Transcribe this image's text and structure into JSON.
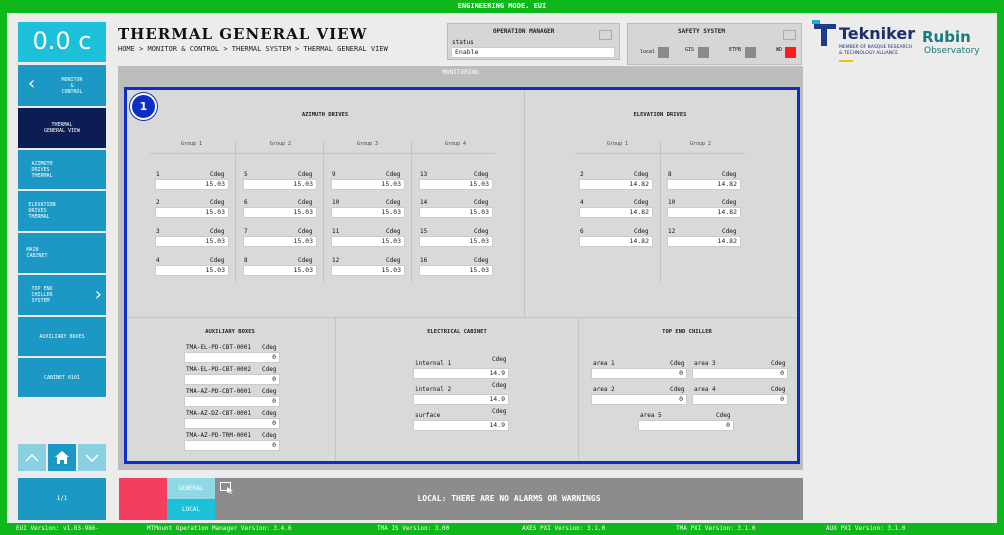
{
  "topbar": {
    "title": "ENGINEERING MODE. EUI"
  },
  "temperature": "0.0 c",
  "nav": {
    "items": [
      {
        "label": "MONITOR\n&\nCONTROL"
      },
      {
        "label": "THERMAL\nGENERAL VIEW"
      },
      {
        "label": "AZIMUTH\nDRIVES\nTHERMAL"
      },
      {
        "label": "ELEVATION\nDRIVES\nTHERMAL"
      },
      {
        "label": "MAIN\nCABINET"
      },
      {
        "label": "TOP END\nCHILLER\nSYSTEM"
      },
      {
        "label": "AUXILIARY BOXES"
      },
      {
        "label": "CABINET 0101"
      }
    ],
    "pager": "1/1"
  },
  "header": {
    "title": "THERMAL GENERAL VIEW",
    "breadcrumb": "HOME > MONITOR & CONTROL > THERMAL SYSTEM > THERMAL GENERAL VIEW"
  },
  "operation_manager": {
    "title": "OPERATION MANAGER",
    "status_label": "status",
    "status_value": "Enable"
  },
  "safety_system": {
    "title": "SAFETY SYSTEM",
    "items": [
      {
        "label": "local",
        "color": "#8a8a8a"
      },
      {
        "label": "GIS",
        "color": "#8a8a8a"
      },
      {
        "label": "ETPB",
        "color": "#8a8a8a"
      },
      {
        "label": "WD",
        "color": "#ff1a1a"
      }
    ]
  },
  "logos": {
    "tekniker": "Tekniker",
    "tekniker_sub1": "MEMBER OF BASQUE RESEARCH",
    "tekniker_sub2": "& TECHNOLOGY ALLIANCE",
    "rubin1": "Rubin",
    "rubin2": "Observatory"
  },
  "monitoring": {
    "title": "MONITORING",
    "badge": "1",
    "azimuth": {
      "title": "AZIMUTH DRIVES",
      "unit": "Cdeg",
      "groups": [
        {
          "name": "Group 1",
          "drives": [
            {
              "id": "1",
              "value": "15.03"
            },
            {
              "id": "2",
              "value": "15.03"
            },
            {
              "id": "3",
              "value": "15.03"
            },
            {
              "id": "4",
              "value": "15.03"
            }
          ]
        },
        {
          "name": "Group 2",
          "drives": [
            {
              "id": "5",
              "value": "15.03"
            },
            {
              "id": "6",
              "value": "15.03"
            },
            {
              "id": "7",
              "value": "15.03"
            },
            {
              "id": "8",
              "value": "15.03"
            }
          ]
        },
        {
          "name": "Group 3",
          "drives": [
            {
              "id": "9",
              "value": "15.03"
            },
            {
              "id": "10",
              "value": "15.03"
            },
            {
              "id": "11",
              "value": "15.03"
            },
            {
              "id": "12",
              "value": "15.03"
            }
          ]
        },
        {
          "name": "Group 4",
          "drives": [
            {
              "id": "13",
              "value": "15.03"
            },
            {
              "id": "14",
              "value": "15.03"
            },
            {
              "id": "15",
              "value": "15.03"
            },
            {
              "id": "16",
              "value": "15.03"
            }
          ]
        }
      ]
    },
    "elevation": {
      "title": "ELEVATION DRIVES",
      "unit": "Cdeg",
      "groups": [
        {
          "name": "Group 1",
          "drives": [
            {
              "id": "2",
              "value": "14.82"
            },
            {
              "id": "4",
              "value": "14.82"
            },
            {
              "id": "6",
              "value": "14.82"
            }
          ]
        },
        {
          "name": "Group 2",
          "drives": [
            {
              "id": "8",
              "value": "14.82"
            },
            {
              "id": "10",
              "value": "14.82"
            },
            {
              "id": "12",
              "value": "14.82"
            }
          ]
        }
      ]
    },
    "auxiliary": {
      "title": "AUXILIARY BOXES",
      "unit": "Cdeg",
      "items": [
        {
          "name": "TMA-EL-PD-CBT-0001",
          "value": "0"
        },
        {
          "name": "TMA-EL-PD-CBT-0002",
          "value": "0"
        },
        {
          "name": "TMA-AZ-PD-CBT-0001",
          "value": "0"
        },
        {
          "name": "TMA-AZ-DZ-CBT-0001",
          "value": "0"
        },
        {
          "name": "TMA-AZ-PD-TRM-0001",
          "value": "0"
        }
      ]
    },
    "electrical": {
      "title": "ELECTRICAL CABINET",
      "unit": "Cdeg",
      "items": [
        {
          "name": "internal 1",
          "value": "14.9"
        },
        {
          "name": "internal 2",
          "value": "14.9"
        },
        {
          "name": "surface",
          "value": "14.9"
        }
      ]
    },
    "chiller": {
      "title": "TOP END CHILLER",
      "unit": "Cdeg",
      "items": [
        {
          "name": "area 1",
          "value": "0"
        },
        {
          "name": "area 3",
          "value": "0"
        },
        {
          "name": "area 2",
          "value": "0"
        },
        {
          "name": "area 4",
          "value": "0"
        },
        {
          "name": "area 5",
          "value": "0"
        }
      ]
    }
  },
  "alarms": {
    "tab_general": "GENERAL",
    "tab_local": "LOCAL",
    "message": "LOCAL: THERE ARE NO ALARMS OR WARNINGS"
  },
  "footer": {
    "items": [
      "EUI Version: v1.03-986-",
      "MTMount Operation Manager Version: 3.4.6",
      "TMA IS Version: 3.00",
      "AXES PXI Version: 3.1.0",
      "TMA PXI Version: 3.1.0",
      "AUX PXI Version: 3.1.0"
    ]
  }
}
